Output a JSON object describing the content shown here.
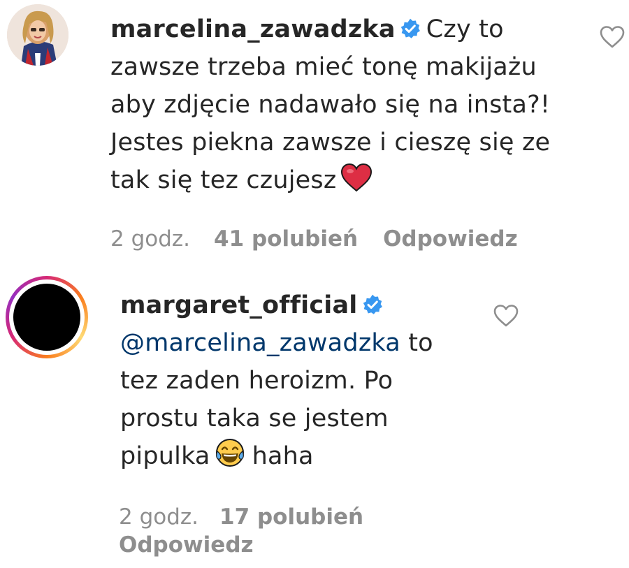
{
  "comments": [
    {
      "username": "marcelina_zawadzka",
      "verified": true,
      "avatar": "photo-avatar",
      "text_lines": [
        "Czy to",
        "zawsze trzeba mieć tonę makijażu",
        "aby zdjęcie nadawało się na insta?!",
        "Jestes piekna zawsze i cieszę się ze",
        "tak się tez czujesz"
      ],
      "emoji": "red-heart",
      "time": "2 godz.",
      "likes": "41 polubień",
      "reply": "Odpowiedz"
    },
    {
      "username": "margaret_official",
      "verified": true,
      "avatar": "story-ring-avatar",
      "mention": "@marcelina_zawadzka",
      "text_lines": [
        "to",
        "tez zaden heroizm. Po",
        "prostu taka se jestem",
        "pipulka",
        "haha"
      ],
      "emoji": "face-with-tears-of-joy",
      "time": "2 godz.",
      "likes": "17 polubień",
      "reply": "Odpowiedz"
    }
  ],
  "colors": {
    "text": "#262626",
    "meta": "#8e8e8e",
    "mention": "#00376b",
    "verified": "#3897f0",
    "heart_emoji": "#e0245e"
  }
}
